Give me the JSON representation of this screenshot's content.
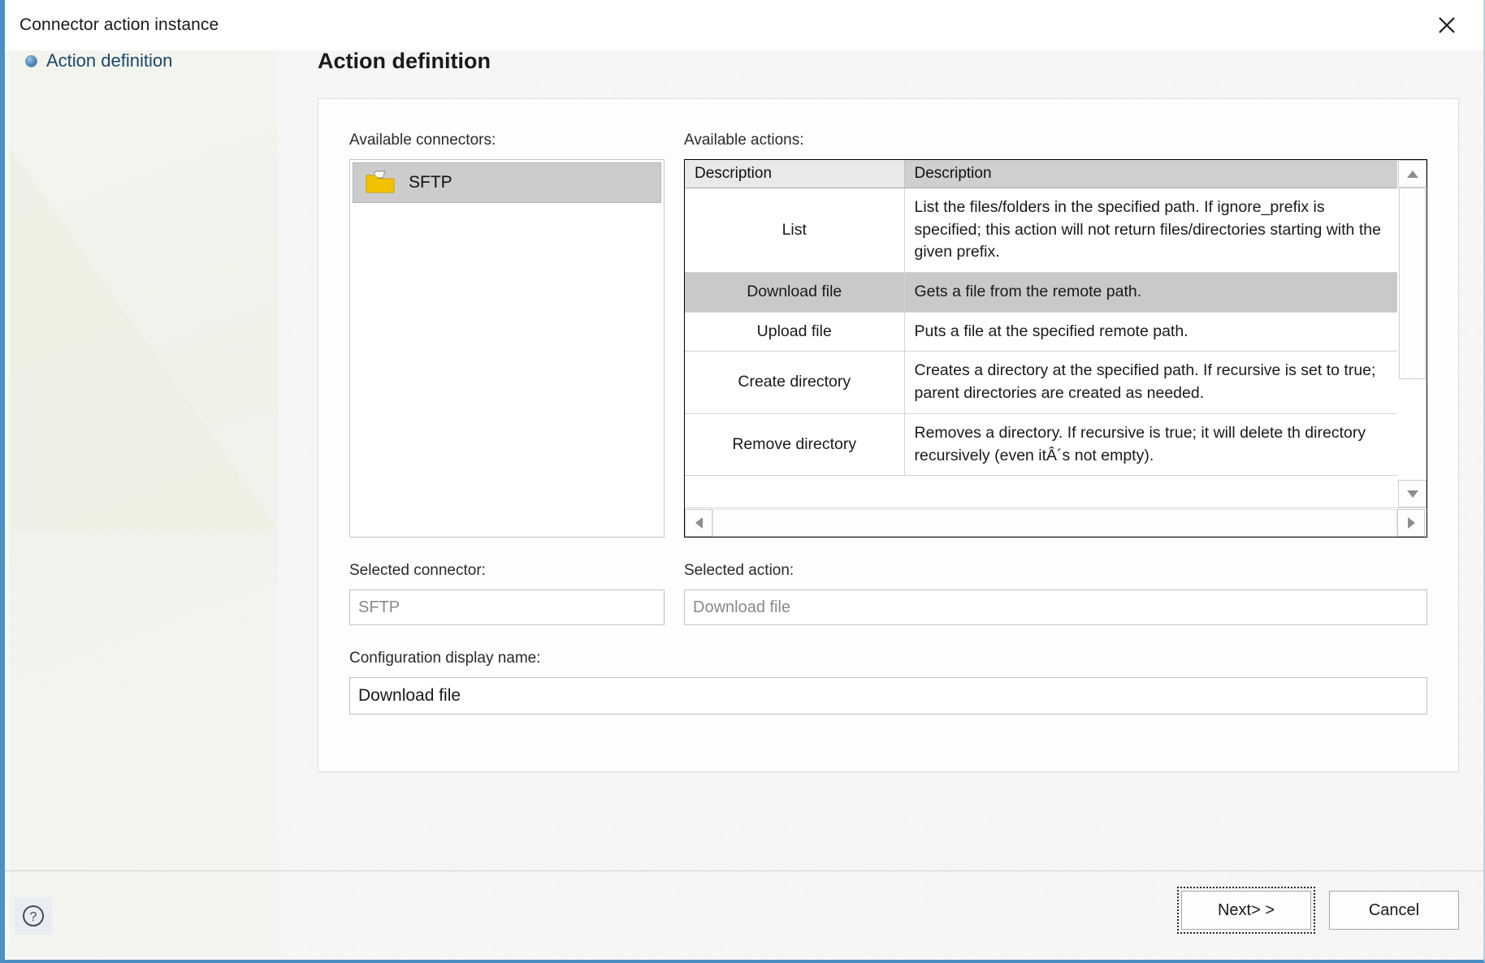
{
  "window": {
    "title": "Connector action instance",
    "close_icon": "close-icon"
  },
  "sidebar": {
    "items": [
      {
        "label": "Action definition",
        "icon": "blue-bullet-icon",
        "selected": true
      }
    ]
  },
  "page": {
    "title": "Action definition"
  },
  "connectors": {
    "label": "Available connectors:",
    "items": [
      {
        "label": "SFTP",
        "icon": "folder-icon",
        "selected": true
      }
    ]
  },
  "actions": {
    "label": "Available actions:",
    "columns": [
      "Description",
      "Description"
    ],
    "rows": [
      {
        "name": "List",
        "description": "List the files/folders in the specified path. If ignore_prefix is specified; this action will not return files/directories starting with the given prefix.",
        "selected": false
      },
      {
        "name": "Download file",
        "description": "Gets a file from the remote path.",
        "selected": true
      },
      {
        "name": "Upload file",
        "description": "Puts a file at the specified remote path.",
        "selected": false
      },
      {
        "name": "Create directory",
        "description": "Creates a directory at the specified path. If recursive is set to true; parent directories are created as needed.",
        "selected": false
      },
      {
        "name": "Remove directory",
        "description": "Removes a directory. If recursive is true; it will delete th directory recursively (even itÂ´s not empty).",
        "selected": false
      }
    ],
    "scroll_up_icon": "triangle-up-icon",
    "scroll_down_icon": "triangle-down-icon",
    "scroll_left_icon": "triangle-left-icon",
    "scroll_right_icon": "triangle-right-icon"
  },
  "selected_connector": {
    "label": "Selected connector:",
    "value": "SFTP"
  },
  "selected_action": {
    "label": "Selected action:",
    "value": "Download file"
  },
  "display_name": {
    "label": "Configuration display name:",
    "value": "Download file"
  },
  "footer": {
    "help_icon": "help-question-icon",
    "next_label": "Next> >",
    "cancel_label": "Cancel"
  },
  "colors": {
    "accent": "#4a90c4",
    "selection": "#cccccc",
    "nav_text": "#17486b",
    "folder": "#f2c200"
  }
}
